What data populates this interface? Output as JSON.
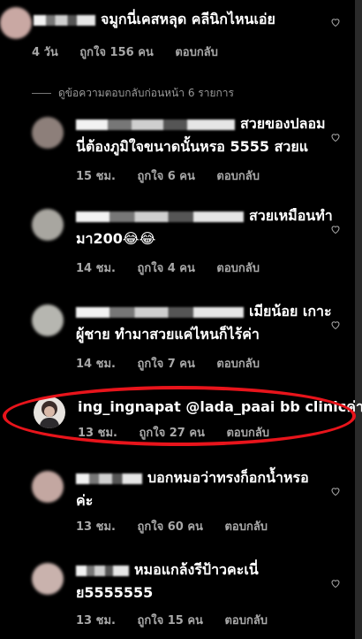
{
  "comments": [
    {
      "text": "จมูกนี่เคสหลุด คลีนิกไหนเอ่ย",
      "time": "4 วัน",
      "likes": "ถูกใจ 156 คน",
      "reply": "ตอบกลับ"
    },
    {
      "text_line1": "สวยของปลอม",
      "text_line2": "นี่ต้องภูมิใจขนาดนั้นหรอ 5555 สวยแ",
      "time": "15 ชม.",
      "likes": "ถูกใจ 6 คน",
      "reply": "ตอบกลับ"
    },
    {
      "text_line1": "สวยเหมือนทำ",
      "text_line2": "มา200😂😂",
      "time": "14 ชม.",
      "likes": "ถูกใจ 4 คน",
      "reply": "ตอบกลับ"
    },
    {
      "text_line1": "เมียน้อย เกาะ",
      "text_line2": "ผู้ชาย ทำมาสวยแค่ไหนก็ไร้ค่า",
      "time": "14 ชม.",
      "likes": "ถูกใจ 7 คน",
      "reply": "ตอบกลับ"
    },
    {
      "username": "ing_ingnapat",
      "mention": "@lada_paai",
      "text": "bb clinicค่า",
      "time": "13 ชม.",
      "likes": "ถูกใจ 27 คน",
      "reply": "ตอบกลับ"
    },
    {
      "text_line1": "บอกหมอว่าทรงก็อกน้ำหรอ",
      "text_line2": "ค่ะ",
      "time": "13 ชม.",
      "likes": "ถูกใจ 60 คน",
      "reply": "ตอบกลับ"
    },
    {
      "text_line1": "หมอแกล้งรีป้าวคะเนี่",
      "text_line2": "ย5555555",
      "time": "13 ชม.",
      "likes": "ถูกใจ 15 คน",
      "reply": "ตอบกลับ"
    }
  ],
  "view_previous": "ดูข้อความตอบกลับก่อนหน้า 6 รายการ",
  "colors": {
    "highlight": "#e8141b",
    "meta": "#a8a8a8",
    "background": "#000000"
  }
}
